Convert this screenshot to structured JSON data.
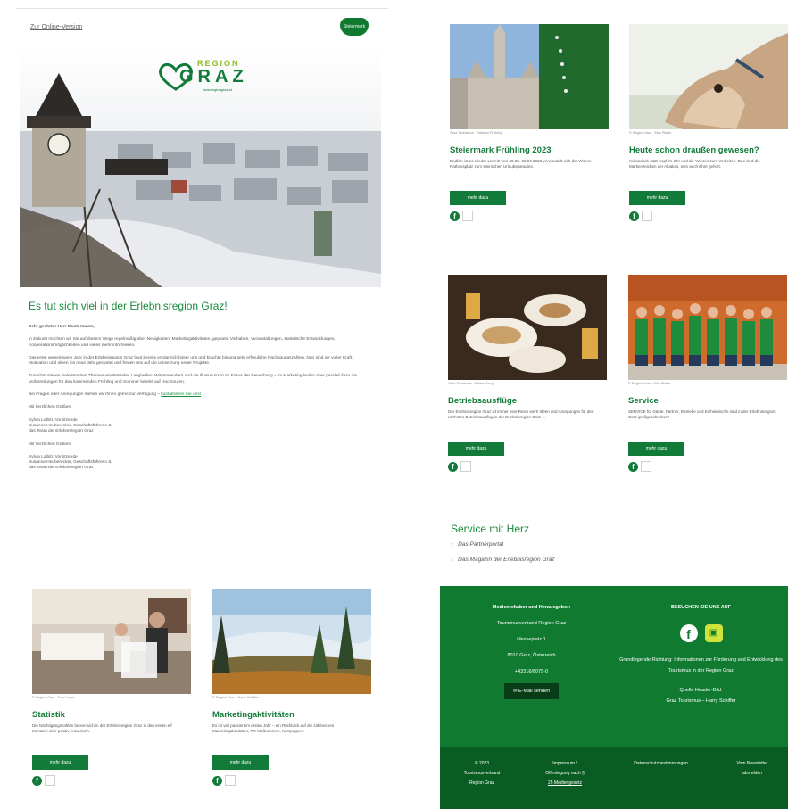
{
  "header": {
    "online_link": "Zur Online-Version",
    "badge": "Steiermark"
  },
  "logo": {
    "region": "REGION",
    "graz": "GRAZ",
    "url": "www.regiongraz.at"
  },
  "intro": {
    "title": "Es tut sich viel in der Erlebnisregion Graz!",
    "greeting": "Sehr geehrter Herr Mustermann,",
    "p1": "in Zukunft möchten wir Sie auf diesem Wege regelmäßig über Neuigkeiten, Marketingaktivitäten, geplante Vorhaben, Veranstaltungen, statistische Entwicklungen, Kooperationsmöglichkeiten und vieles mehr informieren.",
    "p2": "Das erste gemeinsame Jahr in der Erlebnisregion Graz liegt bereits erfolgreich hinter uns und brachte bislang sehr erfreuliche Nächtigungszahlen. Nun sind wir voller Kraft, Motivation und Ideen ins neue Jahr gestartet und freuen uns auf die Umsetzung neuer Projekte.",
    "p3": "Zunächst stehen viele Wochen Themen wie Betriebe, Langlaufen, Winterwandern und die Illusion Expo im Fokus der Bewerbung – im Marketing laufen aber parallel dazu die Vorbereitungen für den kommenden Frühling und Sommer bereits auf Hochtouren.",
    "p4_text": "Bei Fragen oder Anregungen stehen wir Ihnen gerne zur Verfügung – ",
    "p4_link": "kontaktieren Sie uns!",
    "closing1": "Mit herzlichen Grüßen",
    "sig1_l1": "Sylvia Loibitt, Vorsitzende",
    "sig1_l2": "Susanne Heuberecker, Geschäftsführerin &",
    "sig1_l3": "das Team der Erlebnisregion Graz",
    "closing2": "Mit herzlichen Grüßen",
    "sig2_l1": "Sylvia Loibitt, Vorsitzende",
    "sig2_l2": "Susanne Heuberecker, Geschäftsführerin &",
    "sig2_l3": "das Team der Erlebnisregion Graz"
  },
  "cards": [
    {
      "credit": "© Region Graz · Tom Lamm",
      "title": "Statistik",
      "text": "Die Nächtigungszahlen lassen sich in der Erlebnisregion Graz in den ersten elf Monaten sehr positiv entwickeln.",
      "button": "mehr dazu"
    },
    {
      "credit": "© Region Graz · Harry Schiffer",
      "title": "Marketingaktivitäten",
      "text": "Es ist viel passiert im ersten Jahr – ein Rückblick auf die zahlreichen Marketingaktivitäten, PR-Maßnahmen, Kampagnen.",
      "button": "mehr dazu"
    },
    {
      "credit": "Graz Tourismus · Rathaus Frühling",
      "title": "Steiermark Frühling 2023",
      "text": "Endlich ist es wieder soweit! Von 30.03.-02.04.2023 verwandelt sich der Wiener Rathausplatz zum steirischen Urlaubsparadies.",
      "button": "mehr dazu"
    },
    {
      "credit": "© Region Graz · Max Pfaller",
      "title": "Heute schon draußen gewesen?",
      "text": "Kulinarisch statt Kopf im Ohr und die Wiesen zum Verbeiten. Das sind die Markenzeichen der Alpakas, wen auch Ehre gehört.",
      "button": "mehr dazu"
    },
    {
      "credit": "Graz Tourismus · Fabian Krug",
      "title": "Betriebsausflüge",
      "text": "Der Erlebnisregion Graz ist immer eine Reise wert! Ideen und Anregungen für den nächsten Betriebsausflug in der Erlebnisregion Graz …",
      "button": "mehr dazu"
    },
    {
      "credit": "© Region Graz · Max Pfaller",
      "title": "Service",
      "text": "SERVICE für Gäste, Partner, Betriebe und Einheimische sind in der Erlebnisregion Graz großgeschrieben!",
      "button": "mehr dazu"
    }
  ],
  "service": {
    "title": "Service mit Herz",
    "items": [
      "Das Partnerportal",
      "Das Magazin der Erlebnisregion Graz"
    ]
  },
  "footer": {
    "left_heading": "Medieninhaber und Herausgeber:",
    "org": "Tourismusverband Region Graz",
    "street": "Messeplatz 1",
    "city": "8010 Graz, Österreich",
    "phone": "+43316/8075-0",
    "mail_button": "E-Mail senden",
    "right_heading": "BESUCHEN SIE UNS AUF",
    "purpose": "Grundlegende Richtung: Informationen zur Förderung und Entwicklung des Tourismus in der Region Graz",
    "source_l1": "Quelle Header-Bild:",
    "source_l2": "Graz Tourismus – Harry Schiffer",
    "copyright_l1": "© 2023",
    "copyright_l2": "Tourismusverband",
    "copyright_l3": "Region Graz",
    "imprint_l1": "Impressum /",
    "imprint_l2": "Offenlegung nach §",
    "imprint_l3": "25 Mediengesetz",
    "privacy": "Datenschutzbestimmungen",
    "unsub_l1": "Vom Newsletter",
    "unsub_l2": "abmelden"
  },
  "colors": {
    "brand_green": "#137b3a",
    "footer_green": "#0f7a30",
    "footer_dark": "#0a5d22",
    "accent_lime": "#8fbc23"
  }
}
